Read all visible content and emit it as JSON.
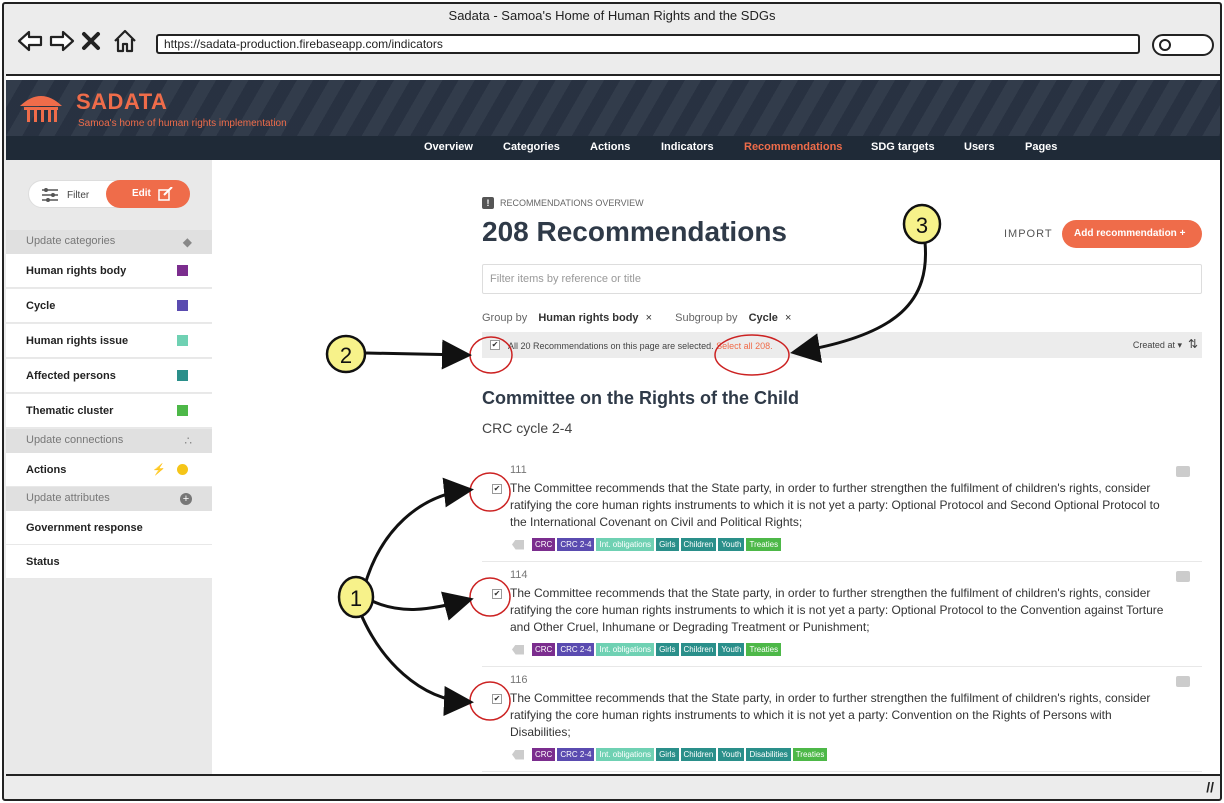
{
  "window": {
    "title": "Sadata - Samoa's Home of Human Rights and the SDGs",
    "url": "https://sadata-production.firebaseapp.com/indicators"
  },
  "brand": {
    "name": "SADATA",
    "tagline": "Samoa's home of human rights implementation"
  },
  "nav": {
    "items": [
      "Overview",
      "Categories",
      "Actions",
      "Indicators",
      "Recommendations",
      "SDG targets",
      "Users",
      "Pages"
    ],
    "active": "Recommendations"
  },
  "sidebar": {
    "filter_label": "Filter",
    "edit_label": "Edit",
    "update_categories": "Update categories",
    "categories": [
      {
        "label": "Human rights body",
        "color": "#7b2d8e"
      },
      {
        "label": "Cycle",
        "color": "#5a4bb0"
      },
      {
        "label": "Human rights issue",
        "color": "#6fd1b3"
      },
      {
        "label": "Affected persons",
        "color": "#2a8f8a"
      },
      {
        "label": "Thematic cluster",
        "color": "#4db848"
      }
    ],
    "update_connections": "Update connections",
    "connections": [
      {
        "label": "Actions",
        "color": "#f5c518"
      }
    ],
    "update_attributes": "Update attributes",
    "attributes": [
      {
        "label": "Government response"
      },
      {
        "label": "Status"
      }
    ]
  },
  "main": {
    "overview_label": "RECOMMENDATIONS OVERVIEW",
    "title": "208 Recommendations",
    "import_label": "IMPORT",
    "add_label": "Add recommendation +",
    "filter_placeholder": "Filter items by reference or title",
    "group_by_label": "Group by",
    "group_by_value": "Human rights body",
    "subgroup_label": "Subgroup by",
    "subgroup_value": "Cycle",
    "remove_symbol": "×",
    "selection_message": "All 20 Recommendations on this page are selected.",
    "select_all": "Select all 208.",
    "sort_label": "Created at",
    "sort_caret": "▾",
    "group_title": "Committee on the Rights of the Child",
    "subgroup_title": "CRC cycle 2-4",
    "recommendations": [
      {
        "ref": "111",
        "text": "The Committee recommends that the State party, in order to further strengthen the fulfilment of children's rights, consider ratifying the core human rights instruments to which it is not yet a party: Optional Protocol and Second Optional Protocol to the International Covenant on Civil and Political Rights;",
        "tags": [
          "CRC",
          "CRC 2-4",
          "Int. obligations",
          "Girls",
          "Children",
          "Youth",
          "Treaties"
        ]
      },
      {
        "ref": "114",
        "text": "The Committee recommends that the State party, in order to further strengthen the fulfilment of children's rights, consider ratifying the core human rights instruments to which it is not yet a party: Optional Protocol to the Convention against Torture and Other Cruel, Inhumane or Degrading Treatment or Punishment;",
        "tags": [
          "CRC",
          "CRC 2-4",
          "Int. obligations",
          "Girls",
          "Children",
          "Youth",
          "Treaties"
        ]
      },
      {
        "ref": "116",
        "text": "The Committee recommends that the State party, in order to further strengthen the fulfilment of children's rights, consider ratifying the core human rights instruments to which it is not yet a party: Convention on the Rights of Persons with Disabilities;",
        "tags": [
          "CRC",
          "CRC 2-4",
          "Int. obligations",
          "Girls",
          "Children",
          "Youth",
          "Disabilities",
          "Treaties"
        ]
      }
    ]
  },
  "annotations": {
    "one": "1",
    "two": "2",
    "three": "3"
  },
  "colors": {
    "accent": "#ef6c4a",
    "header": "#2a3444",
    "navbar": "#1f2a37",
    "annotation_yellow": "#f7f28a",
    "annotation_red": "#cc2222"
  }
}
